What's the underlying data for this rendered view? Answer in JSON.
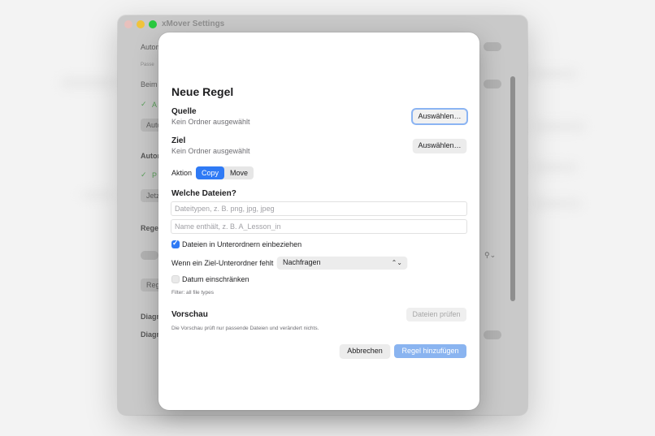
{
  "window": {
    "title": "xMover Settings",
    "background_texts": {
      "autom_1": "Autom",
      "passe": "Passe",
      "beim": "Beim",
      "check_1": "A",
      "auto_button": "Auto",
      "autom_2": "Autom",
      "check_2": "P",
      "jetz_button": "Jetz",
      "regel": "Regel",
      "reg_button": "Reg",
      "diagn_1": "Diagn",
      "diagn_2": "Diagn"
    }
  },
  "sheet": {
    "title": "Neue Regel",
    "source": {
      "label": "Quelle",
      "value": "Kein Ordner ausgewählt",
      "button": "Auswählen…"
    },
    "target": {
      "label": "Ziel",
      "value": "Kein Ordner ausgewählt",
      "button": "Auswählen…"
    },
    "action": {
      "label": "Aktion",
      "options": [
        "Copy",
        "Move"
      ],
      "selected": "Copy"
    },
    "files": {
      "heading": "Welche Dateien?",
      "types_placeholder": "Dateitypen, z. B. png, jpg, jpeg",
      "name_placeholder": "Name enthält, z. B. A_Lesson_in",
      "subfolders_label": "Dateien in Unterordnern einbeziehen",
      "subfolders_checked": true,
      "missing_subfolder_label": "Wenn ein Ziel-Unterordner fehlt",
      "missing_subfolder_value": "Nachfragen",
      "date_label": "Datum einschränken",
      "date_checked": false,
      "filter_summary": "Filter: all file types"
    },
    "preview": {
      "heading": "Vorschau",
      "button": "Dateien prüfen",
      "note": "Die Vorschau prüft nur passende Dateien und verändert nichts."
    },
    "footer": {
      "cancel": "Abbrechen",
      "add": "Regel hinzufügen"
    }
  },
  "colors": {
    "accent": "#2f7af5",
    "primary_disabled": "#8ab4f0",
    "green": "#29c940",
    "yellow": "#f0c33c"
  }
}
